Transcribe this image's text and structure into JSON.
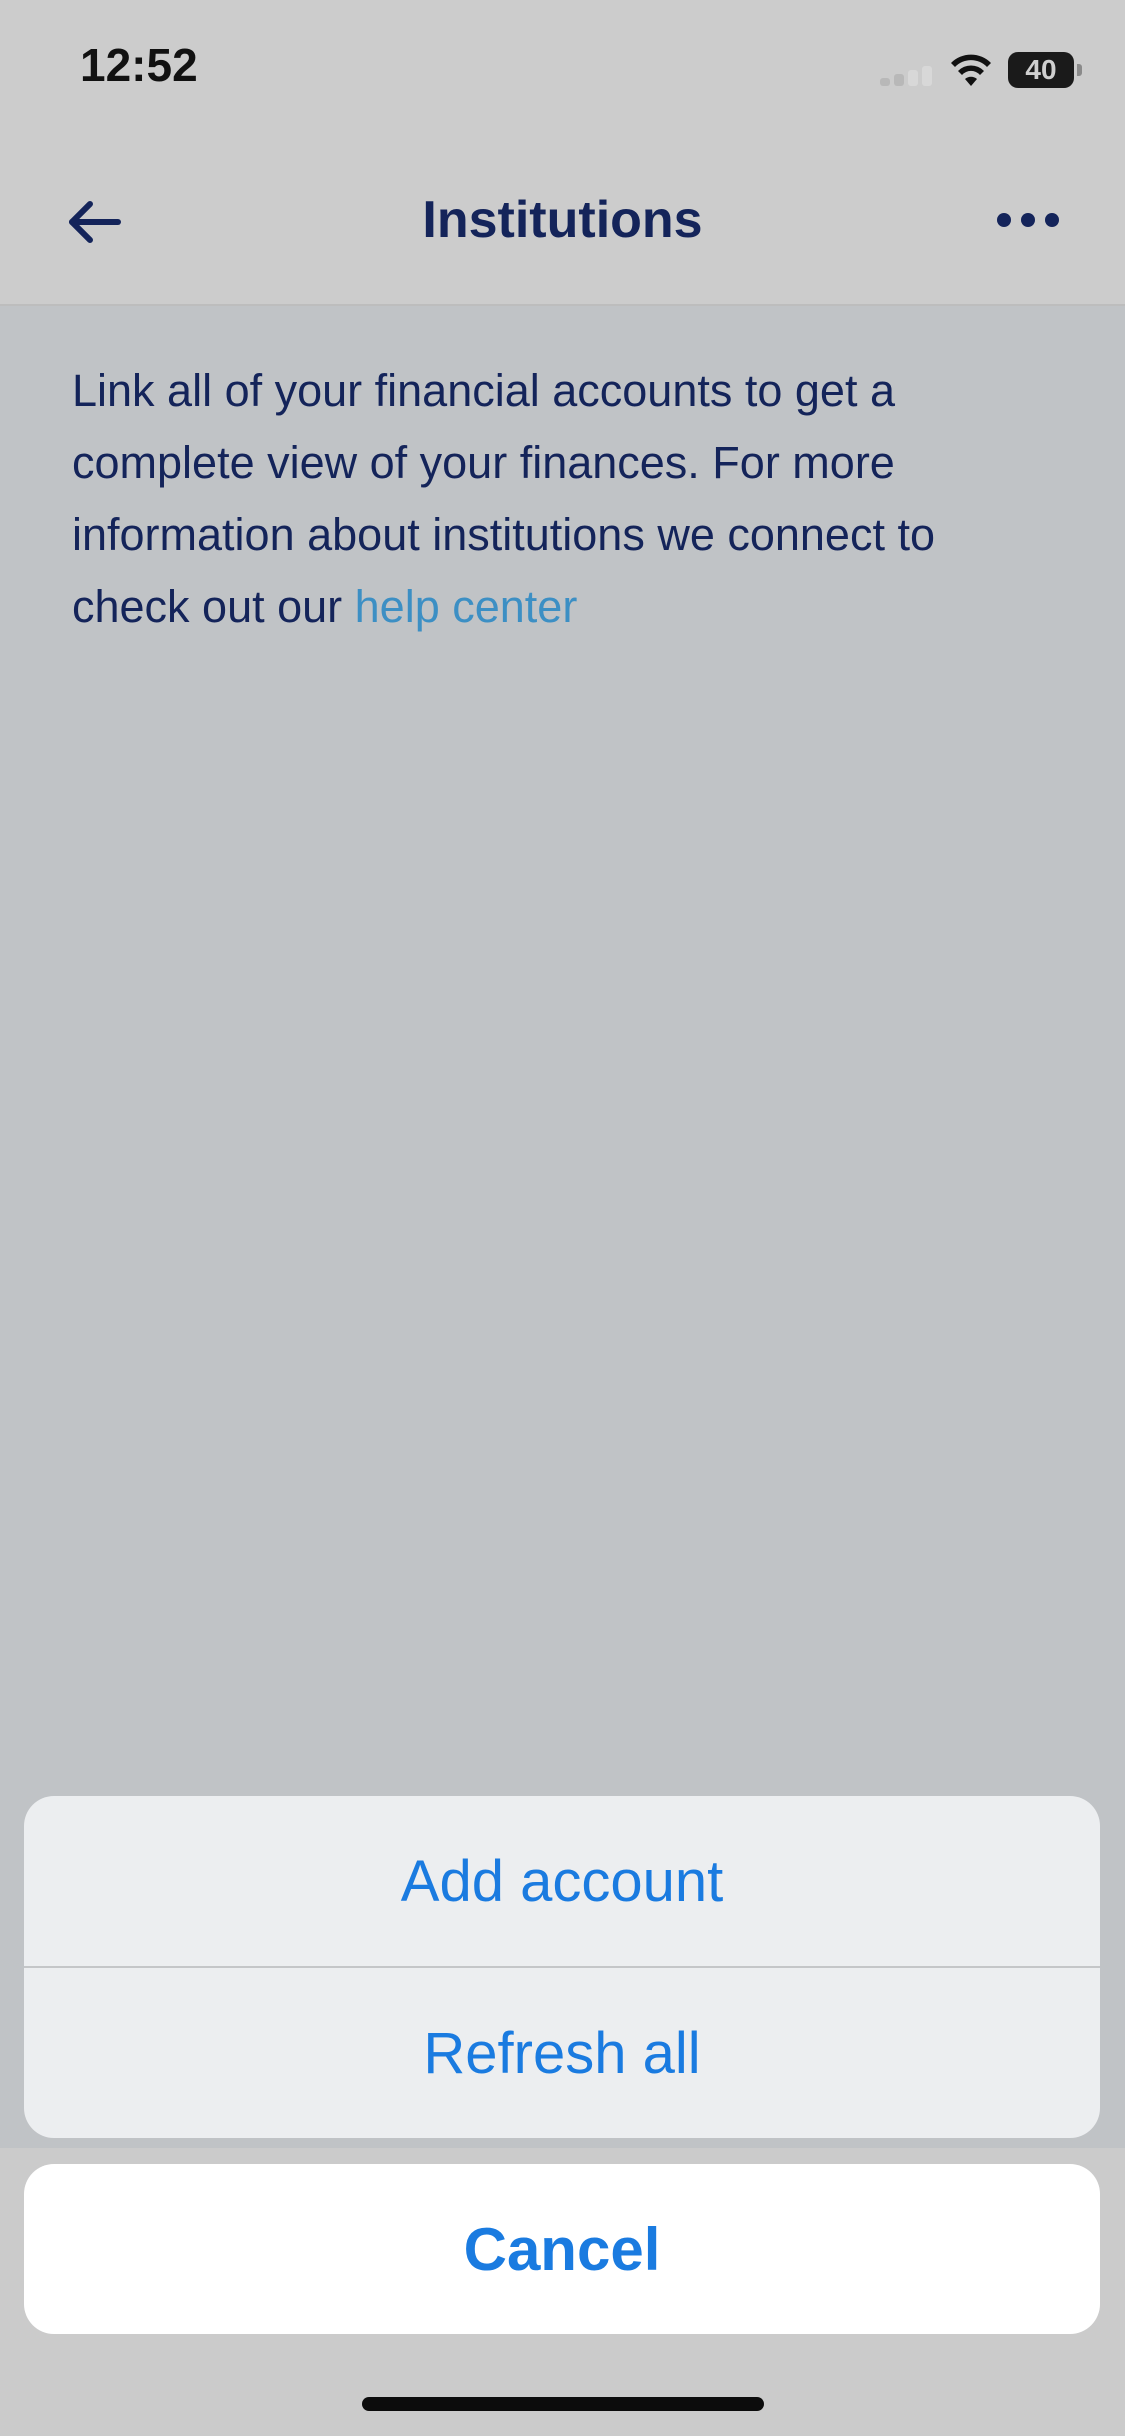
{
  "status_bar": {
    "time": "12:52",
    "battery": "40"
  },
  "nav": {
    "title": "Institutions",
    "back_icon": "arrow-left-icon",
    "more_icon": "more-horizontal-icon"
  },
  "content": {
    "intro_text": "Link all of your financial accounts to get a complete view of your finances. For more information about institutions we connect to check out our ",
    "help_link": "help center"
  },
  "action_sheet": {
    "actions": [
      {
        "label": "Add account"
      },
      {
        "label": "Refresh all"
      }
    ],
    "cancel_label": "Cancel"
  },
  "colors": {
    "title": "#14245a",
    "link": "#3c8fc4",
    "action": "#1a7be0"
  }
}
